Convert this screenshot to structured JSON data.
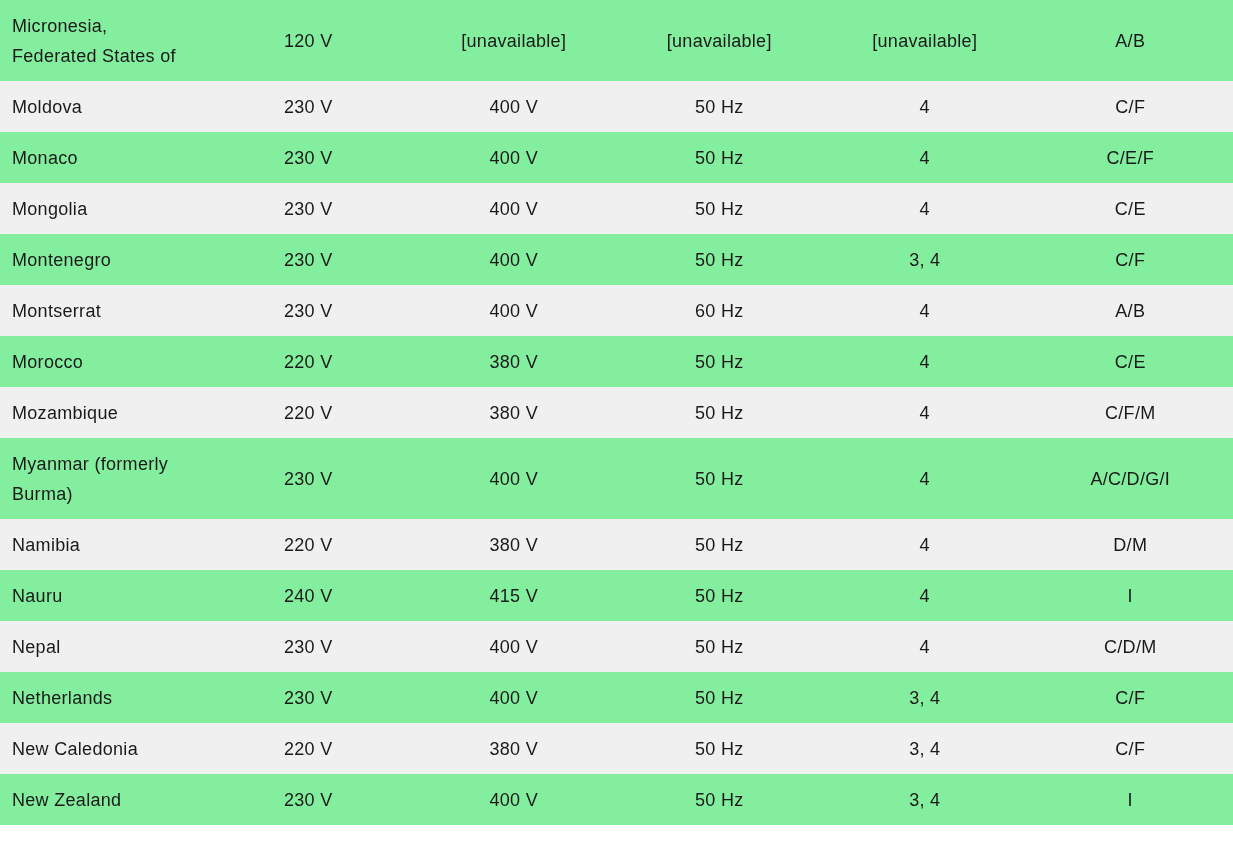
{
  "table": {
    "rows": [
      [
        "Micronesia, Federated States of",
        "120 V",
        "[unavailable]",
        "[unavailable]",
        "[unavailable]",
        "A/B"
      ],
      [
        "Moldova",
        "230 V",
        "400 V",
        "50 Hz",
        "4",
        "C/F"
      ],
      [
        "Monaco",
        "230 V",
        "400 V",
        "50 Hz",
        "4",
        "C/E/F"
      ],
      [
        "Mongolia",
        "230 V",
        "400 V",
        "50 Hz",
        "4",
        "C/E"
      ],
      [
        "Montenegro",
        "230 V",
        "400 V",
        "50 Hz",
        "3, 4",
        "C/F"
      ],
      [
        "Montserrat",
        "230 V",
        "400 V",
        "60 Hz",
        "4",
        "A/B"
      ],
      [
        "Morocco",
        "220 V",
        "380 V",
        "50 Hz",
        "4",
        "C/E"
      ],
      [
        "Mozambique",
        "220 V",
        "380 V",
        "50 Hz",
        "4",
        "C/F/M"
      ],
      [
        "Myanmar (formerly Burma)",
        "230 V",
        "400 V",
        "50 Hz",
        "4",
        "A/C/D/G/I"
      ],
      [
        "Namibia",
        "220 V",
        "380 V",
        "50 Hz",
        "4",
        "D/M"
      ],
      [
        "Nauru",
        "240 V",
        "415 V",
        "50 Hz",
        "4",
        "I"
      ],
      [
        "Nepal",
        "230 V",
        "400 V",
        "50 Hz",
        "4",
        "C/D/M"
      ],
      [
        "Netherlands",
        "230 V",
        "400 V",
        "50 Hz",
        "3, 4",
        "C/F"
      ],
      [
        "New Caledonia",
        "220 V",
        "380 V",
        "50 Hz",
        "3, 4",
        "C/F"
      ],
      [
        "New Zealand",
        "230 V",
        "400 V",
        "50 Hz",
        "3, 4",
        "I"
      ]
    ]
  }
}
